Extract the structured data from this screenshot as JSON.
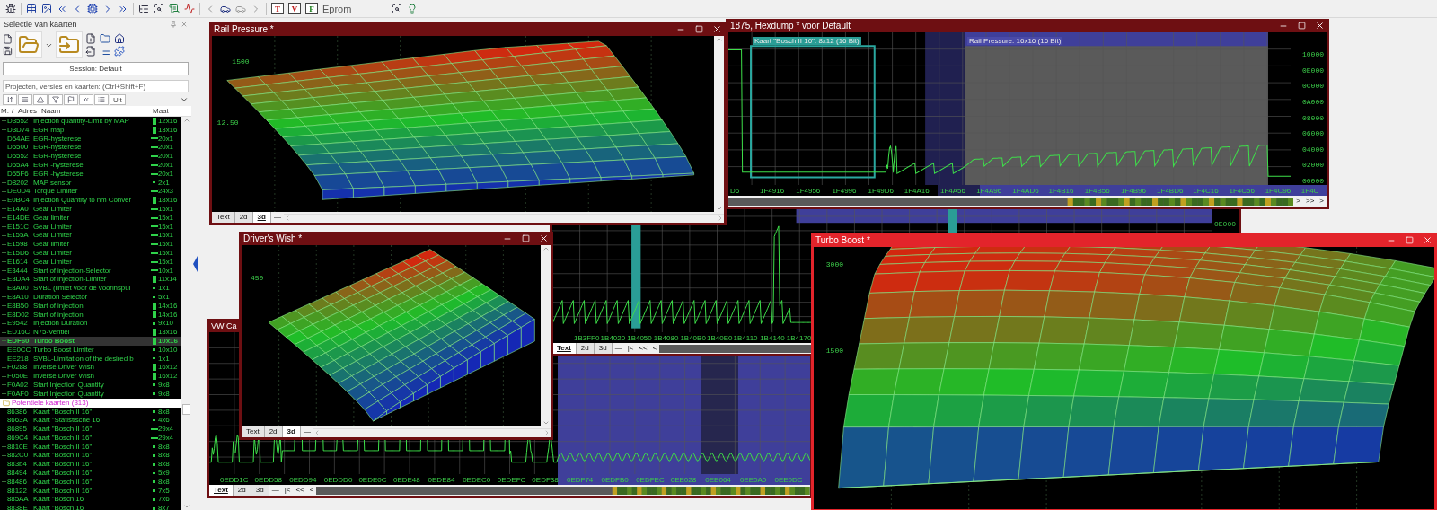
{
  "toolbar": {
    "letter_buttons": [
      "T",
      "V",
      "F"
    ],
    "label": "Eprom"
  },
  "map_panel": {
    "title": "Selectie van kaarten",
    "session_button": "Session: Default",
    "search": {
      "placeholder": "Projecten, versies en kaarten: (Ctrl+Shift+F)"
    },
    "filter_button": "Uit",
    "columns": [
      "M.",
      "/",
      "Adres",
      "Naam",
      "Maat"
    ],
    "rows": [
      {
        "address": "D3552",
        "name": "Injection quantity-Limit by MAP",
        "size": "12x16",
        "kind": "map",
        "expandable": true,
        "selected": false
      },
      {
        "address": "D3D74",
        "name": "EGR map",
        "size": "13x16",
        "kind": "map",
        "expandable": true,
        "selected": false
      },
      {
        "address": "D54AE",
        "name": "EGR-hysterese",
        "size": "20x1",
        "kind": "curve",
        "expandable": false,
        "selected": false
      },
      {
        "address": "D5500",
        "name": "EGR-hysterese",
        "size": "20x1",
        "kind": "curve",
        "expandable": false,
        "selected": false
      },
      {
        "address": "D5552",
        "name": "EGR-hysterese",
        "size": "20x1",
        "kind": "curve",
        "expandable": false,
        "selected": false
      },
      {
        "address": "D55A4",
        "name": "EGR -hysterese",
        "size": "20x1",
        "kind": "curve",
        "expandable": false,
        "selected": false
      },
      {
        "address": "D55F6",
        "name": "EGR -hysterese",
        "size": "20x1",
        "kind": "curve",
        "expandable": false,
        "selected": false
      },
      {
        "address": "D8202",
        "name": "MAP sensor",
        "size": "2x1",
        "kind": "value",
        "expandable": true,
        "selected": false
      },
      {
        "address": "DE0D4",
        "name": "Torque Limiter",
        "size": "24x3",
        "kind": "curve",
        "expandable": true,
        "selected": false
      },
      {
        "address": "E0BC4",
        "name": "Injection Quantity to nm Conver",
        "size": "18x16",
        "kind": "map",
        "expandable": true,
        "selected": false
      },
      {
        "address": "E14A0",
        "name": "Gear Limiter",
        "size": "15x1",
        "kind": "curve",
        "expandable": true,
        "selected": false
      },
      {
        "address": "E14DE",
        "name": "Gear limiter",
        "size": "15x1",
        "kind": "curve",
        "expandable": true,
        "selected": false
      },
      {
        "address": "E151C",
        "name": "Gear Limiter",
        "size": "15x1",
        "kind": "curve",
        "expandable": true,
        "selected": false
      },
      {
        "address": "E155A",
        "name": "Gear Limiter",
        "size": "15x1",
        "kind": "curve",
        "expandable": true,
        "selected": false
      },
      {
        "address": "E1598",
        "name": "Gear limiter",
        "size": "15x1",
        "kind": "curve",
        "expandable": true,
        "selected": false
      },
      {
        "address": "E15D6",
        "name": "Gear Limiter",
        "size": "15x1",
        "kind": "curve",
        "expandable": true,
        "selected": false
      },
      {
        "address": "E1614",
        "name": "Gear Limiter",
        "size": "15x1",
        "kind": "curve",
        "expandable": true,
        "selected": false
      },
      {
        "address": "E3444",
        "name": "Start of injection-Selector",
        "size": "10x1",
        "kind": "curve",
        "expandable": true,
        "selected": false
      },
      {
        "address": "E3DA4",
        "name": "Start of injection-Limiter",
        "size": "11x14",
        "kind": "map",
        "expandable": true,
        "selected": false
      },
      {
        "address": "E8A00",
        "name": "SVBL (limiet voor de voorinspui",
        "size": "1x1",
        "kind": "value",
        "expandable": false,
        "selected": false
      },
      {
        "address": "E8A10",
        "name": "Duration Selector",
        "size": "5x1",
        "kind": "value",
        "expandable": true,
        "selected": false
      },
      {
        "address": "E8B50",
        "name": "Start of injection",
        "size": "14x16",
        "kind": "map",
        "expandable": true,
        "selected": false
      },
      {
        "address": "E8D02",
        "name": "Start of injection",
        "size": "14x16",
        "kind": "map",
        "expandable": true,
        "selected": false
      },
      {
        "address": "E9542",
        "name": "Injection Duration",
        "size": "9x10",
        "kind": "small",
        "expandable": true,
        "selected": false
      },
      {
        "address": "ED16C",
        "name": "N75-Ventiel",
        "size": "13x16",
        "kind": "map",
        "expandable": true,
        "selected": false
      },
      {
        "address": "EDF60",
        "name": "Turbo Boost",
        "size": "10x16",
        "kind": "map",
        "expandable": true,
        "selected": true
      },
      {
        "address": "EE0CC",
        "name": "Turbo Boost Limiter",
        "size": "10x10",
        "kind": "small",
        "expandable": false,
        "selected": false
      },
      {
        "address": "EE218",
        "name": "SVBL-Limitation of the desired b",
        "size": "1x1",
        "kind": "value",
        "expandable": false,
        "selected": false
      },
      {
        "address": "F0288",
        "name": "Inverse Driver Wish",
        "size": "16x12",
        "kind": "map",
        "expandable": true,
        "selected": false
      },
      {
        "address": "F050E",
        "name": "Inverse Driver Wish",
        "size": "16x12",
        "kind": "map",
        "expandable": true,
        "selected": false
      },
      {
        "address": "F0A02",
        "name": "Start Injection Quantity",
        "size": "9x8",
        "kind": "small",
        "expandable": true,
        "selected": false
      },
      {
        "address": "F0AF0",
        "name": "Start Injection Quantity",
        "size": "9x8",
        "kind": "small",
        "expandable": true,
        "selected": false
      }
    ],
    "potential": {
      "label": "Potentiele kaarten (313)",
      "rows": [
        {
          "address": "86386",
          "name": "Kaart \"Bosch II 16\"",
          "size": "8x8",
          "kind": "small",
          "expandable": false,
          "selected": false
        },
        {
          "address": "8663A",
          "name": "Kaart \"Statistische 16",
          "size": "4x6",
          "kind": "value",
          "expandable": false,
          "selected": false
        },
        {
          "address": "86895",
          "name": "Kaart \"Bosch II 16\"",
          "size": "29x4",
          "kind": "curve",
          "expandable": false,
          "selected": false
        },
        {
          "address": "869C4",
          "name": "Kaart \"Bosch II 16\"",
          "size": "29x4",
          "kind": "curve",
          "expandable": false,
          "selected": false
        },
        {
          "address": "8810E",
          "name": "Kaart \"Bosch II 16\"",
          "size": "8x8",
          "kind": "small",
          "expandable": true,
          "selected": false
        },
        {
          "address": "882C0",
          "name": "Kaart \"Bosch II 16\"",
          "size": "8x8",
          "kind": "small",
          "expandable": true,
          "selected": false
        },
        {
          "address": "883b4",
          "name": "Kaart \"Bosch II 16\"",
          "size": "8x8",
          "kind": "small",
          "expandable": false,
          "selected": false
        },
        {
          "address": "88494",
          "name": "Kaart \"Bosch II 16\"",
          "size": "5x9",
          "kind": "value",
          "expandable": false,
          "selected": false
        },
        {
          "address": "88486",
          "name": "Kaart \"Bosch II 16\"",
          "size": "8x8",
          "kind": "small",
          "expandable": true,
          "selected": false
        },
        {
          "address": "88122",
          "name": "Kaart \"Bosch II 16\"",
          "size": "7x5",
          "kind": "small",
          "expandable": false,
          "selected": false
        },
        {
          "address": "885AA",
          "name": "Kaart \"Bosch 16",
          "size": "7x6",
          "kind": "small",
          "expandable": false,
          "selected": false
        },
        {
          "address": "8838E",
          "name": "Kaart \"Bosch 16",
          "size": "8x7",
          "kind": "small",
          "expandable": false,
          "selected": false
        }
      ]
    }
  },
  "windows": [
    {
      "kind": "hexdump",
      "title": "VW Ca",
      "active": false,
      "addresses": [
        "0EDD1C",
        "0EDD58",
        "0EDD94",
        "0EDDD0",
        "0EDE0C",
        "0EDE48",
        "0EDE84",
        "0EDEC0",
        "0EDEFC",
        "0EDF38",
        "0EDF74",
        "0EDFB0",
        "0EDFEC",
        "0EE028",
        "0EE064",
        "0EE0A0",
        "0EE0DC"
      ],
      "tabs": [
        {
          "label": "Text",
          "selected": true
        },
        {
          "label": "2d",
          "selected": false
        },
        {
          "label": "3d",
          "selected": false
        }
      ],
      "nav": [
        "—",
        "|<",
        "<<",
        "<"
      ]
    },
    {
      "kind": "hexdump",
      "active": false,
      "addresses": [
        "1B3FF0",
        "1B4020",
        "1B4050",
        "1B4080",
        "1B40B0",
        "1B40E0",
        "1B4110",
        "1B4140",
        "1B4170"
      ],
      "value_labels": [
        "0E000"
      ],
      "tabs": [
        {
          "label": "Text",
          "selected": true
        },
        {
          "label": "2d",
          "selected": false
        },
        {
          "label": "3d",
          "selected": false
        }
      ],
      "nav": [
        "—",
        "|<",
        "<<",
        "<"
      ]
    },
    {
      "kind": "surface",
      "title": "Rail Pressure *",
      "active": false,
      "axis_labels": [
        "1500",
        "12.50"
      ],
      "tabs": [
        {
          "label": "Text",
          "selected": false
        },
        {
          "label": "2d",
          "selected": false
        },
        {
          "label": "3d",
          "selected": true
        }
      ],
      "nav": [
        "—"
      ]
    },
    {
      "kind": "hexdump",
      "title": "1875, Hexdump * voor Default",
      "active": false,
      "map_labels": [
        {
          "text": "Kaart \"Bosch II 16\": 8x12 (16 Bit)",
          "color": "#2a9d96"
        },
        {
          "text": "Rail Pressure: 16x16 (16 Bit)",
          "color": "#4a4aa8"
        }
      ],
      "addresses": [
        "D6",
        "1F4916",
        "1F4956",
        "1F4996",
        "1F49D6",
        "1F4A16",
        "1F4A56",
        "1F4A96",
        "1F4AD6",
        "1F4B16",
        "1F4B56",
        "1F4B96",
        "1F4BD6",
        "1F4C16",
        "1F4C56",
        "1F4C96",
        "1F4C"
      ],
      "value_labels": [
        "10000",
        "0E000",
        "0C000",
        "0A000",
        "08000",
        "06000",
        "04000",
        "02000",
        "00000"
      ],
      "nav": [
        ">",
        ">>",
        ">"
      ]
    },
    {
      "kind": "surface",
      "title": "Driver's Wish *",
      "active": false,
      "axis_labels": [
        "450"
      ],
      "tabs": [
        {
          "label": "Text",
          "selected": false
        },
        {
          "label": "2d",
          "selected": false
        },
        {
          "label": "3d",
          "selected": true
        }
      ],
      "nav": [
        "—"
      ]
    },
    {
      "kind": "surface",
      "title": "Turbo Boost *",
      "active": true,
      "axis_labels": [
        "3000",
        "1500"
      ]
    }
  ]
}
